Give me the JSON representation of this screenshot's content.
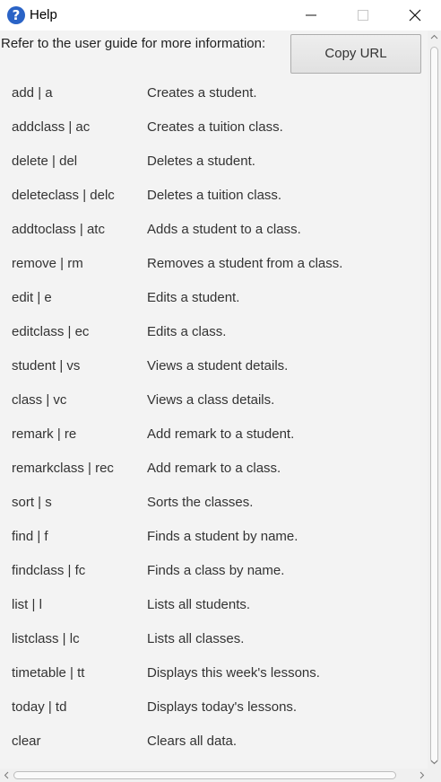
{
  "window": {
    "title": "Help",
    "app_icon": "question-mark-icon",
    "controls": {
      "minimize_icon": "minimize-icon",
      "maximize_icon": "maximize-icon",
      "close_icon": "close-icon"
    }
  },
  "help": {
    "header_text": "Refer to the user guide for more information:",
    "copy_button_label": "Copy URL"
  },
  "commands": [
    {
      "name": "add | a",
      "description": "Creates a student."
    },
    {
      "name": "addclass | ac",
      "description": "Creates a tuition class."
    },
    {
      "name": "delete | del",
      "description": "Deletes a student."
    },
    {
      "name": "deleteclass | delc",
      "description": "Deletes a tuition class."
    },
    {
      "name": "addtoclass | atc",
      "description": "Adds a student to a class."
    },
    {
      "name": "remove | rm",
      "description": "Removes a student from a class."
    },
    {
      "name": "edit | e",
      "description": "Edits a student."
    },
    {
      "name": "editclass | ec",
      "description": "Edits a class."
    },
    {
      "name": "student | vs",
      "description": "Views a student details."
    },
    {
      "name": "class | vc",
      "description": "Views a class details."
    },
    {
      "name": "remark | re",
      "description": "Add remark to a student."
    },
    {
      "name": "remarkclass | rec",
      "description": "Add remark to a class."
    },
    {
      "name": "sort | s",
      "description": "Sorts the classes."
    },
    {
      "name": "find | f",
      "description": "Finds a student by name."
    },
    {
      "name": "findclass | fc",
      "description": "Finds a class by name."
    },
    {
      "name": "list | l",
      "description": "Lists all students."
    },
    {
      "name": "listclass | lc",
      "description": "Lists all classes."
    },
    {
      "name": "timetable | tt",
      "description": "Displays this week's lessons."
    },
    {
      "name": "today | td",
      "description": "Displays today's lessons."
    },
    {
      "name": "clear",
      "description": "Clears all data."
    }
  ],
  "colors": {
    "content_background": "#f3f3f3",
    "text": "#333333",
    "app_icon": "#2a63c6"
  }
}
